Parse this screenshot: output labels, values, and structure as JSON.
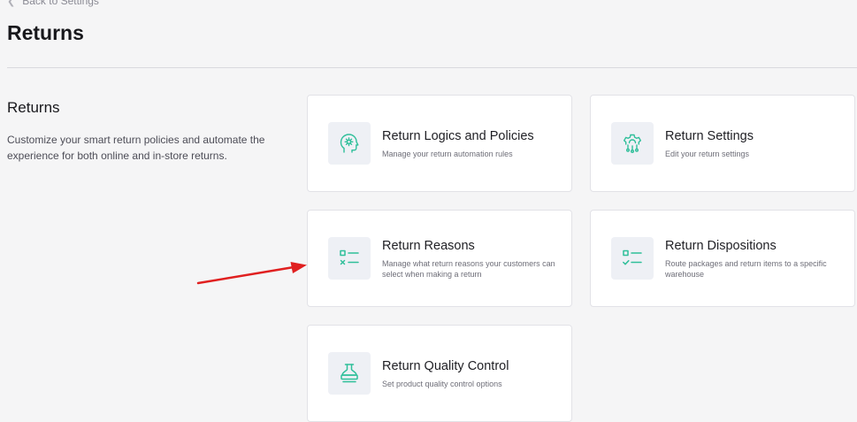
{
  "nav": {
    "back_label": "Back to Settings"
  },
  "page": {
    "title": "Returns"
  },
  "section": {
    "title": "Returns",
    "description": "Customize your smart return policies and automate the experience for both online and in-store returns."
  },
  "cards": [
    {
      "title": "Return Logics and Policies",
      "description": "Manage your return automation rules",
      "icon": "brain-gear-icon"
    },
    {
      "title": "Return Settings",
      "description": "Edit your return settings",
      "icon": "gear-icon"
    },
    {
      "title": "Return Reasons",
      "description": "Manage what return reasons your customers can select when making a return",
      "icon": "checklist-icon"
    },
    {
      "title": "Return Dispositions",
      "description": "Route packages and return items to a specific warehouse",
      "icon": "check-list-icon"
    },
    {
      "title": "Return Quality Control",
      "description": "Set product quality control options",
      "icon": "stamp-icon"
    }
  ],
  "colors": {
    "accent": "#2fbf9a",
    "annotation_arrow": "#e02020"
  }
}
